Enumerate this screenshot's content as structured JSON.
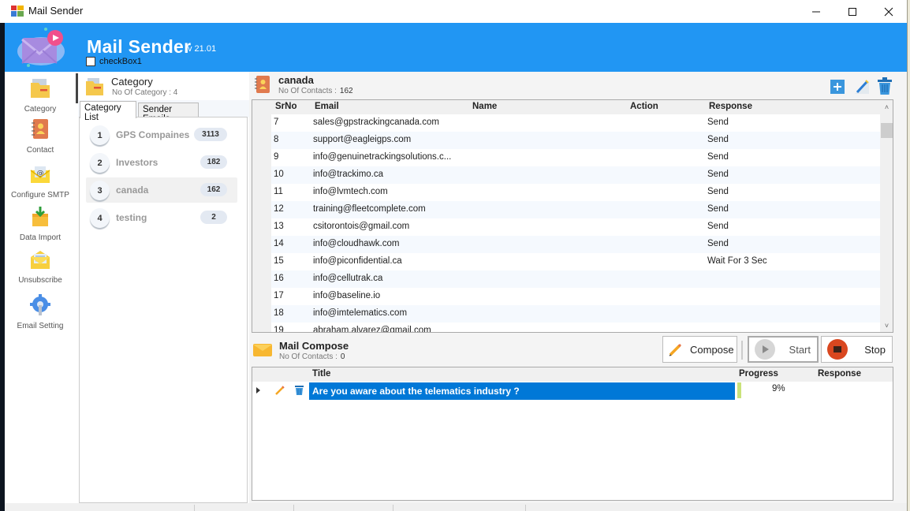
{
  "window": {
    "title": "Mail Sender",
    "controls": {
      "minimize": "–",
      "maximize": "☐",
      "close": "✕"
    }
  },
  "banner": {
    "app_name": "Mail Sender",
    "version": "v 21.01",
    "checkbox_label": "checkBox1",
    "checkbox_checked": false,
    "color": "#2196f3"
  },
  "nav": {
    "items": [
      {
        "label": "Category",
        "icon": "folder-icon"
      },
      {
        "label": "Contact",
        "icon": "contact-book-icon"
      },
      {
        "label": "Configure SMTP",
        "icon": "at-envelope-icon"
      },
      {
        "label": "Data Import",
        "icon": "box-import-icon"
      },
      {
        "label": "Unsubscribe",
        "icon": "open-envelope-icon"
      },
      {
        "label": "Email Setting",
        "icon": "gear-wrench-icon"
      }
    ]
  },
  "category_panel": {
    "title": "Category",
    "subtitle": "No Of Category : 4",
    "tabs": [
      {
        "label": "Category List",
        "active": true
      },
      {
        "label": "Sender Emails",
        "active": false
      }
    ],
    "items": [
      {
        "num": "1",
        "name": "GPS Compaines",
        "count": "3113",
        "selected": false
      },
      {
        "num": "2",
        "name": "Investors",
        "count": "182",
        "selected": false
      },
      {
        "num": "3",
        "name": "canada",
        "count": "162",
        "selected": true
      },
      {
        "num": "4",
        "name": "testing",
        "count": "2",
        "selected": false
      }
    ]
  },
  "contacts": {
    "title": "canada",
    "subtitle_label": "No Of Contacts :",
    "subtitle_value": "162",
    "columns": [
      "SrNo",
      "Email",
      "Name",
      "Action",
      "Response"
    ],
    "rows": [
      {
        "srno": "7",
        "email": "sales@gpstrackingcanada.com",
        "name": "",
        "action": "",
        "response": "Send"
      },
      {
        "srno": "8",
        "email": "support@eagleigps.com",
        "name": "",
        "action": "",
        "response": "Send"
      },
      {
        "srno": "9",
        "email": "info@genuinetrackingsolutions.c...",
        "name": "",
        "action": "",
        "response": "Send"
      },
      {
        "srno": "10",
        "email": "info@trackimo.ca",
        "name": "",
        "action": "",
        "response": "Send"
      },
      {
        "srno": "11",
        "email": "info@lvmtech.com",
        "name": "",
        "action": "",
        "response": "Send"
      },
      {
        "srno": "12",
        "email": "training@fleetcomplete.com",
        "name": "",
        "action": "",
        "response": "Send"
      },
      {
        "srno": "13",
        "email": "csitorontois@gmail.com",
        "name": "",
        "action": "",
        "response": "Send"
      },
      {
        "srno": "14",
        "email": "info@cloudhawk.com",
        "name": "",
        "action": "",
        "response": "Send"
      },
      {
        "srno": "15",
        "email": "info@piconfidential.ca",
        "name": "",
        "action": "",
        "response": "Wait For 3 Sec"
      },
      {
        "srno": "16",
        "email": "info@cellutrak.ca",
        "name": "",
        "action": "",
        "response": ""
      },
      {
        "srno": "17",
        "email": "info@baseline.io",
        "name": "",
        "action": "",
        "response": ""
      },
      {
        "srno": "18",
        "email": "info@imtelematics.com",
        "name": "",
        "action": "",
        "response": ""
      },
      {
        "srno": "19",
        "email": "abraham.alvarez@gmail.com",
        "name": "",
        "action": "",
        "response": ""
      }
    ]
  },
  "compose": {
    "title": "Mail Compose",
    "subtitle_label": "No Of Contacts :",
    "subtitle_value": "0",
    "buttons": {
      "compose": "Compose",
      "start": "Start",
      "stop": "Stop"
    },
    "columns": [
      "Title",
      "Progress",
      "Response"
    ],
    "rows": [
      {
        "title": "Are you aware about the telematics industry ?",
        "progress": "9%",
        "progress_value": 0.09,
        "response": ""
      }
    ]
  }
}
